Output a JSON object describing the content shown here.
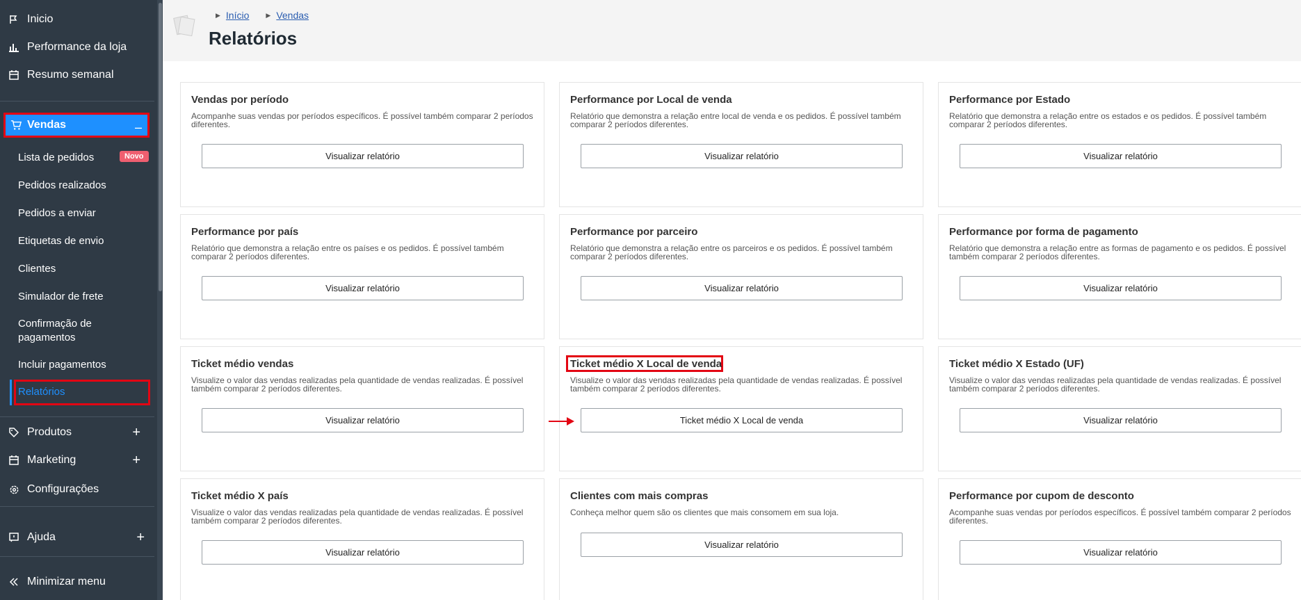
{
  "sidebar": {
    "items": [
      {
        "label": "Inicio",
        "icon": "flag-icon"
      },
      {
        "label": "Performance da loja",
        "icon": "bar-chart-icon"
      },
      {
        "label": "Resumo semanal",
        "icon": "calendar-icon"
      }
    ],
    "vendas": {
      "label": "Vendas",
      "icon": "cart-icon",
      "toggle": "–"
    },
    "vendas_sub": [
      {
        "label": "Lista de pedidos",
        "badge": "Novo"
      },
      {
        "label": "Pedidos realizados"
      },
      {
        "label": "Pedidos a enviar"
      },
      {
        "label": "Etiquetas de envio"
      },
      {
        "label": "Clientes"
      },
      {
        "label": "Simulador de frete"
      },
      {
        "label": "Confirmação de pagamentos"
      },
      {
        "label": "Incluir pagamentos"
      },
      {
        "label": "Relatórios"
      }
    ],
    "produtos": {
      "label": "Produtos",
      "icon": "tag-icon",
      "toggle": "+"
    },
    "marketing": {
      "label": "Marketing",
      "icon": "calendar-icon",
      "toggle": "+"
    },
    "configuracoes": {
      "label": "Configurações",
      "icon": "gear-icon"
    },
    "ajuda": {
      "label": "Ajuda",
      "icon": "help-icon",
      "toggle": "+"
    },
    "minimizar": {
      "label": "Minimizar menu",
      "icon": "double-chevron-left-icon"
    }
  },
  "header": {
    "breadcrumb": [
      "Início",
      "Vendas"
    ],
    "title": "Relatórios"
  },
  "cards": [
    {
      "title": "Vendas por período",
      "desc": "Acompanhe suas vendas por períodos específicos. É possível também comparar 2 períodos diferentes.",
      "button": "Visualizar relatório"
    },
    {
      "title": "Performance por Local de venda",
      "desc": "Relatório que demonstra a relação entre local de venda e os pedidos. É possível também comparar 2 períodos diferentes.",
      "button": "Visualizar relatório"
    },
    {
      "title": "Performance por Estado",
      "desc": "Relatório que demonstra a relação entre os estados e os pedidos. É possível também comparar 2 períodos diferentes.",
      "button": "Visualizar relatório"
    },
    {
      "title": "Performance por país",
      "desc": "Relatório que demonstra a relação entre os países e os pedidos. É possível também comparar 2 períodos diferentes.",
      "button": "Visualizar relatório"
    },
    {
      "title": "Performance por parceiro",
      "desc": "Relatório que demonstra a relação entre os parceiros e os pedidos. É possível também comparar 2 períodos diferentes.",
      "button": "Visualizar relatório"
    },
    {
      "title": "Performance por forma de pagamento",
      "desc": "Relatório que demonstra a relação entre as formas de pagamento e os pedidos. É possível também comparar 2 períodos diferentes.",
      "button": "Visualizar relatório"
    },
    {
      "title": "Ticket médio vendas",
      "desc": "Visualize o valor das vendas realizadas pela quantidade de vendas realizadas. É possível também comparar 2 períodos diferentes.",
      "button": "Visualizar relatório"
    },
    {
      "title": "Ticket médio X Local de venda",
      "desc": "Visualize o valor das vendas realizadas pela quantidade de vendas realizadas. É possível também comparar 2 períodos diferentes.",
      "button": "Ticket médio X Local de venda"
    },
    {
      "title": "Ticket médio X Estado (UF)",
      "desc": "Visualize o valor das vendas realizadas pela quantidade de vendas realizadas. É possível também comparar 2 períodos diferentes.",
      "button": "Visualizar relatório"
    },
    {
      "title": "Ticket médio X país",
      "desc": "Visualize o valor das vendas realizadas pela quantidade de vendas realizadas. É possível também comparar 2 períodos diferentes.",
      "button": "Visualizar relatório"
    },
    {
      "title": "Clientes com mais compras",
      "desc": "Conheça melhor quem são os clientes que mais consomem em sua loja.",
      "button": "Visualizar relatório"
    },
    {
      "title": "Performance por cupom de desconto",
      "desc": "Acompanhe suas vendas por períodos específicos. É possível também comparar 2 períodos diferentes.",
      "button": "Visualizar relatório"
    }
  ],
  "colors": {
    "accent": "#1e90ff",
    "highlight": "#e30613",
    "sidebar": "#2f3a45",
    "badge": "#ef5f70"
  }
}
